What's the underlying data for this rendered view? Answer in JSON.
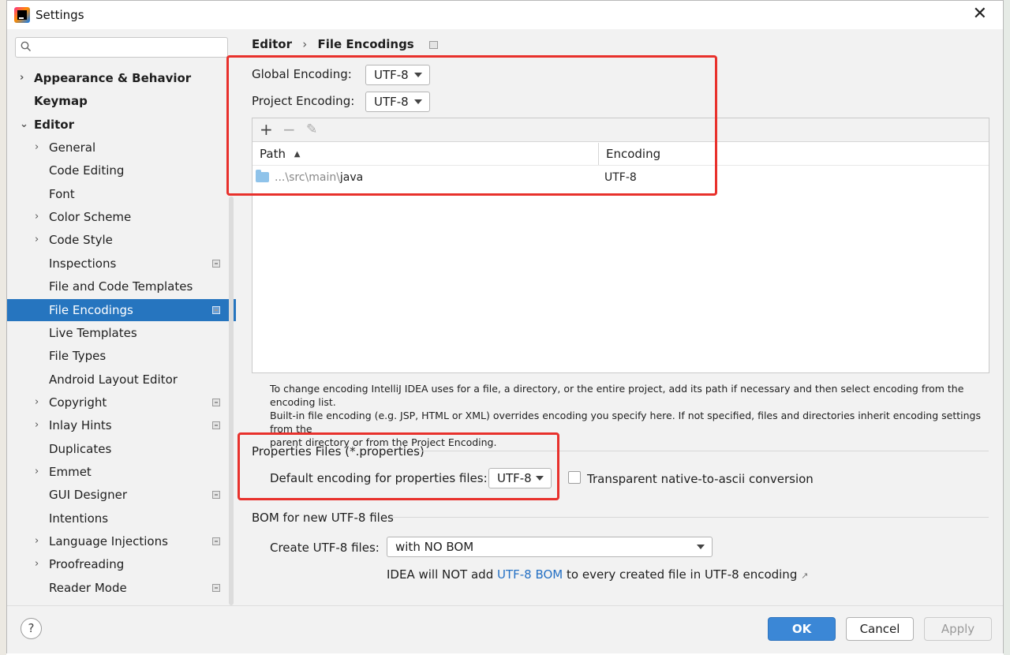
{
  "window": {
    "title": "Settings",
    "close_glyph": "✕"
  },
  "sidebar": {
    "search_placeholder": "",
    "items": [
      {
        "label": "Appearance & Behavior",
        "arrow": "›",
        "bold": true
      },
      {
        "label": "Keymap",
        "bold": true
      },
      {
        "label": "Editor",
        "arrow": "⌄",
        "bold": true
      },
      {
        "label": "General",
        "arrow": "›"
      },
      {
        "label": "Code Editing"
      },
      {
        "label": "Font"
      },
      {
        "label": "Color Scheme",
        "arrow": "›"
      },
      {
        "label": "Code Style",
        "arrow": "›"
      },
      {
        "label": "Inspections",
        "badge": true
      },
      {
        "label": "File and Code Templates"
      },
      {
        "label": "File Encodings",
        "badge": true,
        "selected": true
      },
      {
        "label": "Live Templates"
      },
      {
        "label": "File Types"
      },
      {
        "label": "Android Layout Editor"
      },
      {
        "label": "Copyright",
        "arrow": "›",
        "badge": true
      },
      {
        "label": "Inlay Hints",
        "arrow": "›",
        "badge": true
      },
      {
        "label": "Duplicates"
      },
      {
        "label": "Emmet",
        "arrow": "›"
      },
      {
        "label": "GUI Designer",
        "badge": true
      },
      {
        "label": "Intentions"
      },
      {
        "label": "Language Injections",
        "arrow": "›",
        "badge": true
      },
      {
        "label": "Proofreading",
        "arrow": "›"
      },
      {
        "label": "Reader Mode",
        "badge": true
      }
    ]
  },
  "breadcrumb": {
    "parent": "Editor",
    "separator": "›",
    "current": "File Encodings"
  },
  "encoding": {
    "global_label": "Global Encoding:",
    "global_value": "UTF-8",
    "project_label": "Project Encoding:",
    "project_value": "UTF-8"
  },
  "table": {
    "toolbar": {
      "add": "+",
      "remove": "−",
      "edit": "✎"
    },
    "columns": {
      "path": "Path",
      "sort_glyph": "▲",
      "encoding": "Encoding"
    },
    "rows": [
      {
        "path_prefix": "...\\src\\main\\",
        "path_tail": "java",
        "encoding": "UTF-8"
      }
    ]
  },
  "hint": {
    "line1": "To change encoding IntelliJ IDEA uses for a file, a directory, or the entire project, add its path if necessary and then select encoding from the encoding list.",
    "line2": "Built-in file encoding (e.g. JSP, HTML or XML) overrides encoding you specify here. If not specified, files and directories inherit encoding settings from the",
    "line3": "parent directory or from the Project Encoding."
  },
  "properties": {
    "section_title": "Properties Files (*.properties)",
    "default_label": "Default encoding for properties files:",
    "default_value": "UTF-8",
    "native_checkbox_label": "Transparent native-to-ascii conversion",
    "native_checked": false
  },
  "bom": {
    "section_title": "BOM for new UTF-8 files",
    "create_label": "Create UTF-8 files:",
    "create_value": "with NO BOM",
    "note_prefix": "IDEA will NOT add ",
    "note_link": "UTF-8 BOM",
    "note_suffix": " to every created file in UTF-8 encoding",
    "note_ext_glyph": "↗"
  },
  "footer": {
    "help": "?",
    "ok": "OK",
    "cancel": "Cancel",
    "apply": "Apply"
  },
  "colors": {
    "selection": "#2675bf",
    "ok_button": "#3b87d6",
    "highlight_box": "#e8312c",
    "link": "#2470c4"
  }
}
